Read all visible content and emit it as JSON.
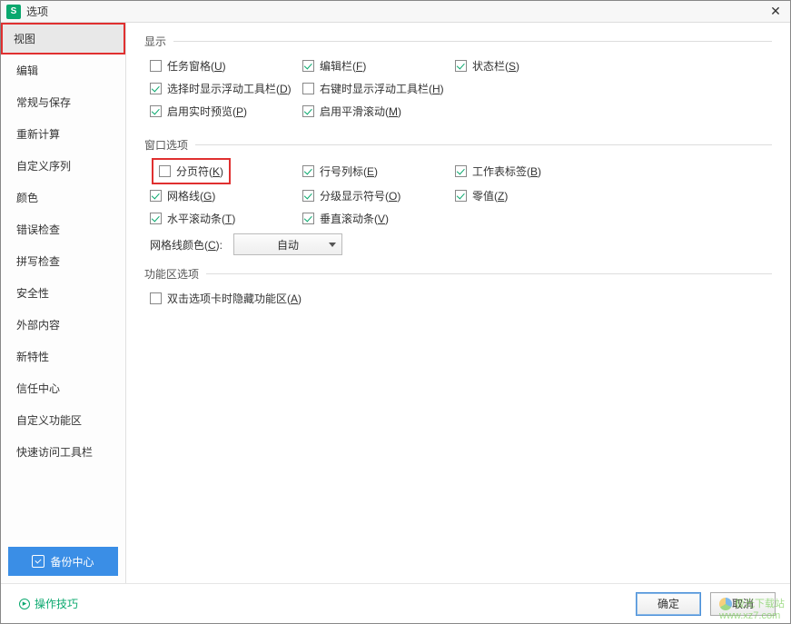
{
  "title": "选项",
  "sidebar": {
    "items": [
      {
        "label": "视图"
      },
      {
        "label": "编辑"
      },
      {
        "label": "常规与保存"
      },
      {
        "label": "重新计算"
      },
      {
        "label": "自定义序列"
      },
      {
        "label": "颜色"
      },
      {
        "label": "错误检查"
      },
      {
        "label": "拼写检查"
      },
      {
        "label": "安全性"
      },
      {
        "label": "外部内容"
      },
      {
        "label": "新特性"
      },
      {
        "label": "信任中心"
      },
      {
        "label": "自定义功能区"
      },
      {
        "label": "快速访问工具栏"
      }
    ],
    "backup_label": "备份中心",
    "tips_label": "操作技巧"
  },
  "sections": {
    "display": {
      "title": "显示",
      "items": {
        "taskpane": {
          "label": "任务窗格(U)",
          "checked": false
        },
        "editbar": {
          "label": "编辑栏(F)",
          "checked": true
        },
        "statusbar": {
          "label": "状态栏(S)",
          "checked": true
        },
        "selecttoolbar": {
          "label": "选择时显示浮动工具栏(D)",
          "checked": true
        },
        "rightclicktoolbar": {
          "label": "右键时显示浮动工具栏(H)",
          "checked": false
        },
        "livepreview": {
          "label": "启用实时预览(P)",
          "checked": true
        },
        "smoothscroll": {
          "label": "启用平滑滚动(M)",
          "checked": true
        }
      }
    },
    "windowopts": {
      "title": "窗口选项",
      "items": {
        "pagebreak": {
          "label": "分页符(K)",
          "checked": false
        },
        "rowcolheader": {
          "label": "行号列标(E)",
          "checked": true
        },
        "sheettabs": {
          "label": "工作表标签(B)",
          "checked": true
        },
        "gridlines": {
          "label": "网格线(G)",
          "checked": true
        },
        "outlinesymbol": {
          "label": "分级显示符号(O)",
          "checked": true
        },
        "zerovalue": {
          "label": "零值(Z)",
          "checked": true
        },
        "hscroll": {
          "label": "水平滚动条(T)",
          "checked": true
        },
        "vscroll": {
          "label": "垂直滚动条(V)",
          "checked": true
        }
      },
      "gridcolor_label": "网格线颜色(C):",
      "gridcolor_value": "自动"
    },
    "ribbon": {
      "title": "功能区选项",
      "items": {
        "dblclickhide": {
          "label": "双击选项卡时隐藏功能区(A)",
          "checked": false
        }
      }
    }
  },
  "buttons": {
    "ok": "确定",
    "cancel": "取消"
  },
  "watermark": {
    "text1": "极光下载站",
    "text2": "www.xz7.com"
  }
}
